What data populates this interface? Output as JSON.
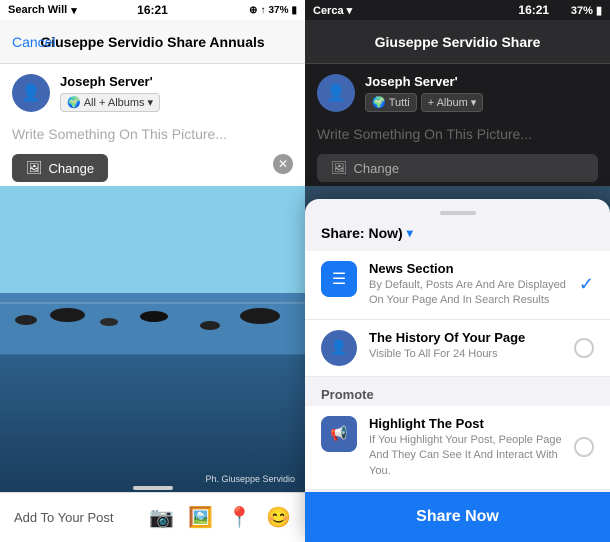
{
  "left": {
    "status_bar": {
      "carrier": "Search Will",
      "time": "16:21",
      "battery": "37%",
      "wifi": "▾"
    },
    "nav": {
      "cancel_label": "Cancel",
      "title": "Giuseppe Servidio Share Annuals"
    },
    "post": {
      "user_name": "Joseph Server'",
      "audience_label": "All + Albums",
      "audience_arrow": "▾",
      "placeholder": "Write Something On This Picture...",
      "change_btn": "Change",
      "photo_credit": "Ph. Giuseppe Servidio"
    },
    "bottom": {
      "label": "Add To Your Post",
      "icons": [
        "📷",
        "🖼️",
        "📍",
        "😊"
      ]
    }
  },
  "right": {
    "status_bar": {
      "carrier": "Cerca",
      "time": "16:21",
      "battery": "37%"
    },
    "nav": {
      "title": "Giuseppe Servidio Share"
    },
    "post": {
      "user_name": "Joseph Server'",
      "audience_label": "Tutti",
      "album_label": "+ Album",
      "placeholder": "Write Something On This Picture..."
    },
    "change_btn": "Change"
  },
  "share_sheet": {
    "title": "Share: Now)",
    "title_arrow": "▾",
    "items": [
      {
        "id": "news-section",
        "icon_type": "news",
        "title": "News Section",
        "subtitle": "By Default, Posts Are And Are Displayed On Your Page And In Search Results",
        "control": "check"
      },
      {
        "id": "history",
        "icon_type": "avatar",
        "title": "The History Of Your Page",
        "subtitle": "Visible To All For 24 Hours",
        "control": "radio"
      }
    ],
    "promote_label": "Promote",
    "promote_items": [
      {
        "id": "highlight",
        "icon_type": "megaphone",
        "title": "Highlight The Post",
        "subtitle": "If You Highlight Your Post, People Page And They Can See It And Interact With You.",
        "control": "radio"
      }
    ],
    "share_now_label": "Share Now"
  }
}
